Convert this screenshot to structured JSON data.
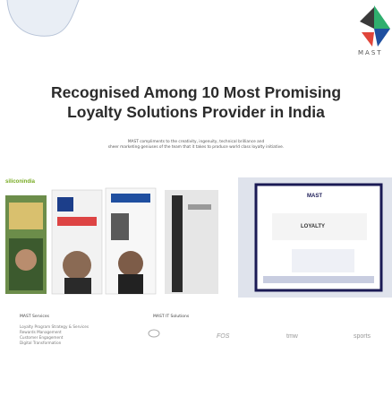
{
  "brand": {
    "logo_text": "MAST"
  },
  "headline": {
    "line1": "Recognised Among 10 Most Promising",
    "line2": "Loyalty Solutions Provider in India"
  },
  "tagline": {
    "line1": "MAST compliments to the creativity, ingenuity, technical brilliance and",
    "line2": "sheer marketing geniuses of the team that it takes to produce world class loyalty initiative."
  },
  "photos": {
    "left_card_label": "siliconindia",
    "right_card_label": "MAST",
    "right_card_sub": "LOYALTY"
  },
  "footer": {
    "col1_heading": "MAST Services",
    "col1_items": [
      "Loyalty Program Strategy & Services",
      "Rewards Management",
      "Customer Engagement",
      "Digital Transformation"
    ],
    "col2_heading": "MAST IT Solutions",
    "clients": [
      "FOS",
      "tmw",
      "sports"
    ]
  },
  "colors": {
    "accent_green": "#2fae6e",
    "accent_blue": "#1f4fa0",
    "headline": "#2b2b2b"
  }
}
